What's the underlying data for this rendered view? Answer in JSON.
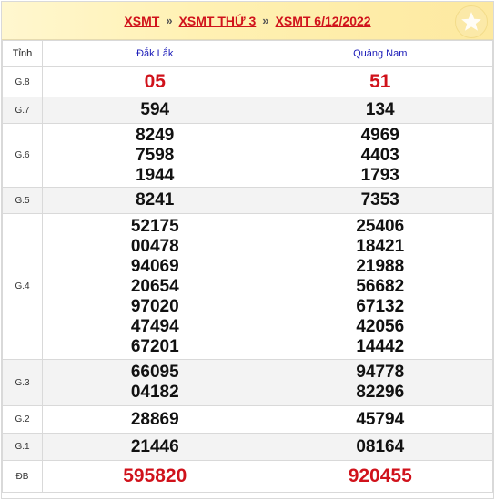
{
  "breadcrumb": [
    "XSMT",
    "XSMT THỨ 3",
    "XSMT 6/12/2022"
  ],
  "breadcrumb_sep": "»",
  "header_label": "Tỉnh",
  "provinces": [
    "Đắk Lắk",
    "Quảng Nam"
  ],
  "rows": [
    {
      "label": "G.8",
      "style": "red",
      "values": [
        [
          "05"
        ],
        [
          "51"
        ]
      ]
    },
    {
      "label": "G.7",
      "style": "",
      "values": [
        [
          "594"
        ],
        [
          "134"
        ]
      ]
    },
    {
      "label": "G.6",
      "style": "",
      "values": [
        [
          "8249",
          "7598",
          "1944"
        ],
        [
          "4969",
          "4403",
          "1793"
        ]
      ]
    },
    {
      "label": "G.5",
      "style": "",
      "values": [
        [
          "8241"
        ],
        [
          "7353"
        ]
      ]
    },
    {
      "label": "G.4",
      "style": "",
      "values": [
        [
          "52175",
          "00478",
          "94069",
          "20654",
          "97020",
          "47494",
          "67201"
        ],
        [
          "25406",
          "18421",
          "21988",
          "56682",
          "67132",
          "42056",
          "14442"
        ]
      ]
    },
    {
      "label": "G.3",
      "style": "",
      "values": [
        [
          "66095",
          "04182"
        ],
        [
          "94778",
          "82296"
        ]
      ]
    },
    {
      "label": "G.2",
      "style": "",
      "values": [
        [
          "28869"
        ],
        [
          "45794"
        ]
      ]
    },
    {
      "label": "G.1",
      "style": "",
      "values": [
        [
          "21446"
        ],
        [
          "08164"
        ]
      ]
    },
    {
      "label": "ĐB",
      "style": "big",
      "values": [
        [
          "595820"
        ],
        [
          "920455"
        ]
      ]
    }
  ],
  "colors": {
    "accent_red": "#d0121b",
    "province_blue": "#1a1ab8",
    "header_bg": "#fff1b3"
  },
  "icons": {
    "badge": "star-icon"
  }
}
